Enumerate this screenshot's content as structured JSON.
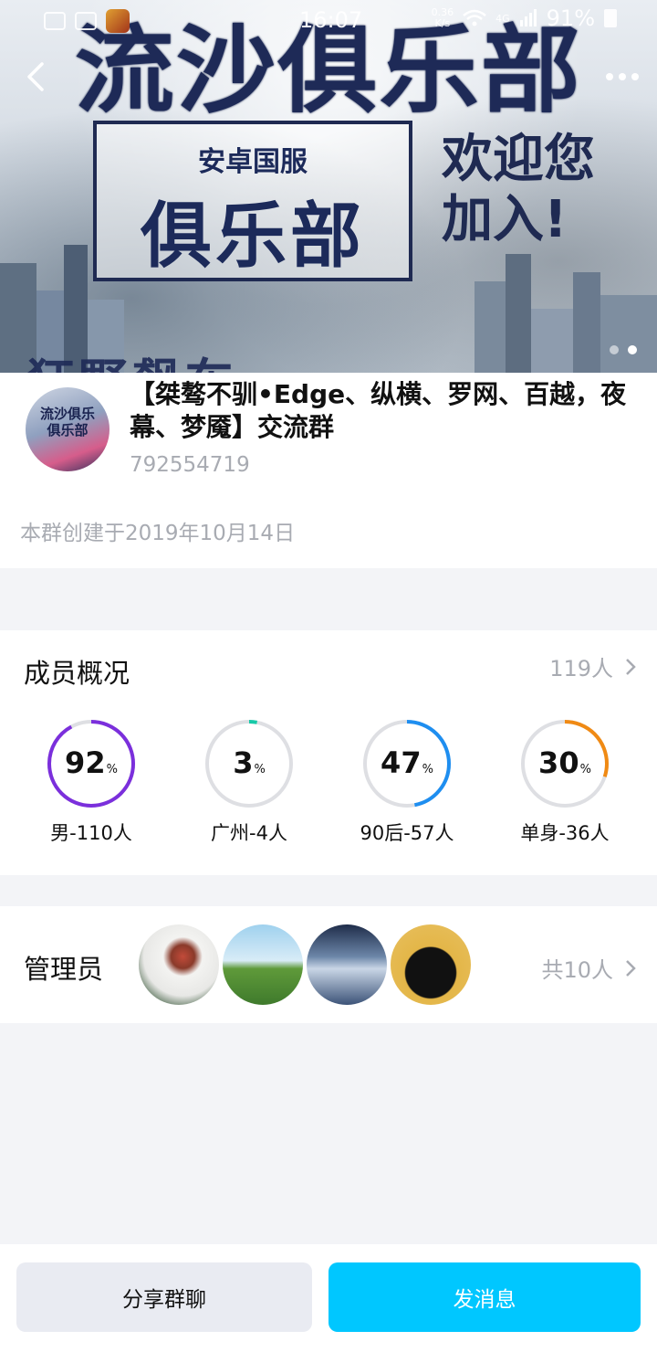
{
  "status_bar": {
    "time": "16:07",
    "net_speed": "0.36\nK/s",
    "network": "4G",
    "battery": "91%"
  },
  "banner": {
    "big_title": "流沙俱乐部",
    "sub_title": "安卓国服",
    "club_word": "俱乐部",
    "welcome_line1": "欢迎您",
    "welcome_line2": "加入!",
    "bottom_text": "狂野飙车",
    "avatar_text_line1": "流沙俱乐",
    "avatar_text_line2": "俱乐部"
  },
  "group": {
    "name": "【桀骜不驯•Edge、纵横、罗网、百越，夜幕、梦魇】交流群",
    "id": "792554719",
    "created": "本群创建于2019年10月14日"
  },
  "members": {
    "title": "成员概况",
    "count": "119人",
    "stats": [
      {
        "value": 92,
        "unit": "%",
        "label": "男-110人",
        "color": "#7b2fdc"
      },
      {
        "value": 3,
        "unit": "%",
        "label": "广州-4人",
        "color": "#17c9a8"
      },
      {
        "value": 47,
        "unit": "%",
        "label": "90后-57人",
        "color": "#1e8ef0"
      },
      {
        "value": 30,
        "unit": "%",
        "label": "单身-36人",
        "color": "#f08a14"
      }
    ]
  },
  "admins": {
    "title": "管理员",
    "count": "共10人",
    "avatars": [
      "bird-avatar",
      "grassland-avatar",
      "sky-avatar",
      "black-cat-avatar"
    ]
  },
  "actions": {
    "share": "分享群聊",
    "send": "发消息"
  },
  "colors": {
    "accent": "#00c7ff",
    "muted_text": "#a8abb2",
    "page_bg": "#f3f4f7"
  }
}
